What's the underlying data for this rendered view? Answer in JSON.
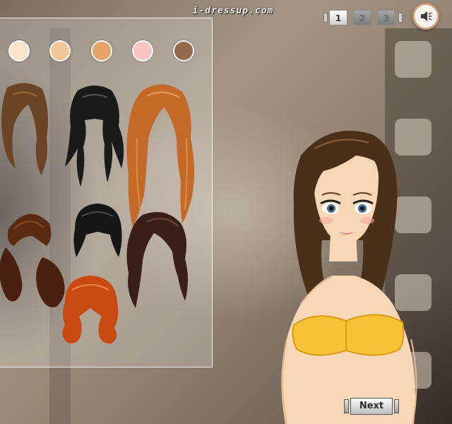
{
  "header": {
    "watermark": "i-dressup.com"
  },
  "page_tabs": [
    {
      "label": "1",
      "state": "active"
    },
    {
      "label": "2",
      "state": "inactive"
    },
    {
      "label": "3",
      "state": "inactive"
    }
  ],
  "sound_button": {
    "icon": "speaker-icon"
  },
  "skin_tones": [
    {
      "name": "skin-tone-fair",
      "color": "#fbe3c8"
    },
    {
      "name": "skin-tone-light",
      "color": "#f3c69a"
    },
    {
      "name": "skin-tone-tan",
      "color": "#e5a266"
    },
    {
      "name": "skin-tone-pink",
      "color": "#f9c4c4"
    },
    {
      "name": "skin-tone-brown",
      "color": "#8f6a4e"
    }
  ],
  "hairstyles": [
    {
      "name": "hair-brown-shoulder",
      "color": "#6a4424"
    },
    {
      "name": "hair-black-bangs-long",
      "color": "#1a1a1a"
    },
    {
      "name": "hair-ginger-long",
      "color": "#c46a28"
    },
    {
      "name": "hair-auburn-pigtails",
      "color": "#5a2a12"
    },
    {
      "name": "hair-black-bob",
      "color": "#161616"
    },
    {
      "name": "hair-dark-wavy",
      "color": "#3a1f18"
    },
    {
      "name": "hair-red-bob",
      "color": "#c84a12"
    }
  ],
  "model": {
    "hair_color": "#4a3018",
    "top_color": "#f7c236"
  },
  "footer": {
    "next_label": "Next"
  }
}
